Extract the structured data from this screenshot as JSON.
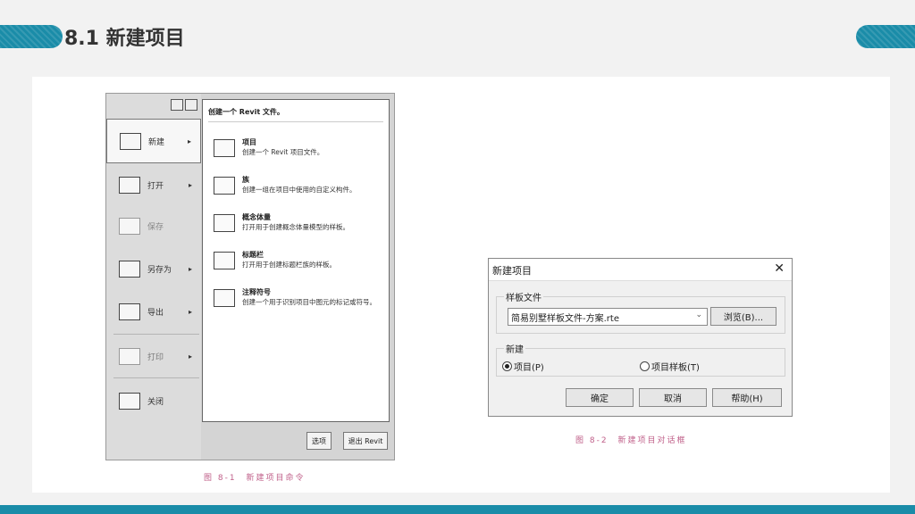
{
  "slide": {
    "title": "8.1 新建项目",
    "accent_color": "#1a8ca8"
  },
  "revit_menu": {
    "items": [
      {
        "label": "新建",
        "icon": "new-file-icon",
        "arrow": "▸"
      },
      {
        "label": "打开",
        "icon": "open-folder-icon",
        "arrow": "▸"
      },
      {
        "label": "保存",
        "icon": "save-icon",
        "arrow": ""
      },
      {
        "label": "另存为",
        "icon": "save-as-icon",
        "arrow": "▸"
      },
      {
        "label": "导出",
        "icon": "export-icon",
        "arrow": "▸"
      },
      {
        "label": "打印",
        "icon": "print-icon",
        "arrow": "▸"
      },
      {
        "label": "关闭",
        "icon": "close-file-icon",
        "arrow": ""
      }
    ],
    "submenu": {
      "header": "创建一个 Revit 文件。",
      "items": [
        {
          "title": "项目",
          "desc": "创建一个 Revit 项目文件。"
        },
        {
          "title": "族",
          "desc": "创建一组在项目中使用的自定义构件。"
        },
        {
          "title": "概念体量",
          "desc": "打开用于创建概念体量模型的样板。"
        },
        {
          "title": "标题栏",
          "desc": "打开用于创建标题栏族的样板。"
        },
        {
          "title": "注释符号",
          "desc": "创建一个用于识别项目中图元的标记或符号。"
        }
      ]
    },
    "options_button": "选项",
    "exit_button": "退出 Revit",
    "caption": "图 8-1　新建项目命令"
  },
  "dialog": {
    "title": "新建项目",
    "template_group": "样板文件",
    "template_value": "简易别墅样板文件-方案.rte",
    "browse_button": "浏览(B)...",
    "new_group": "新建",
    "radio_project": "项目(P)",
    "radio_template": "项目样板(T)",
    "selected": "project",
    "ok_button": "确定",
    "cancel_button": "取消",
    "help_button": "帮助(H)",
    "caption": "图 8-2　新建项目对话框"
  }
}
